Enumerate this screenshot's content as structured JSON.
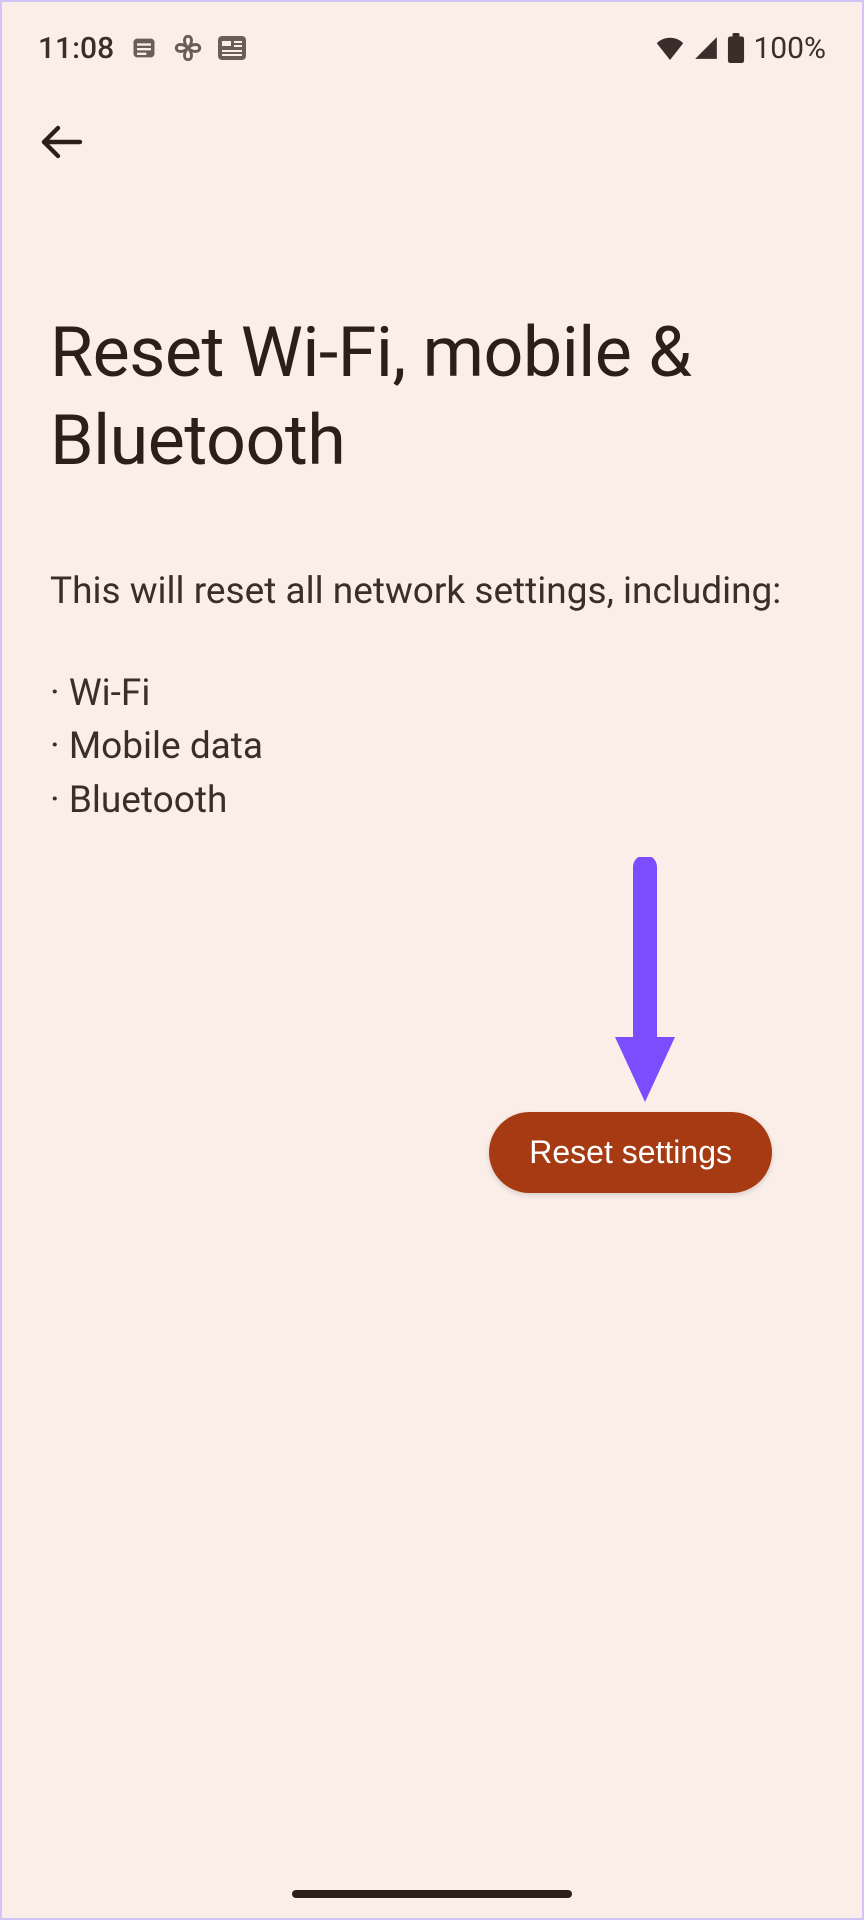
{
  "status_bar": {
    "time": "11:08",
    "battery_percent": "100%"
  },
  "page": {
    "title": "Reset Wi-Fi, mobile & Bluetooth",
    "description": "This will reset all network settings, including:",
    "bullets": [
      "Wi-Fi",
      "Mobile data",
      "Bluetooth"
    ]
  },
  "button": {
    "reset_label": "Reset settings"
  }
}
